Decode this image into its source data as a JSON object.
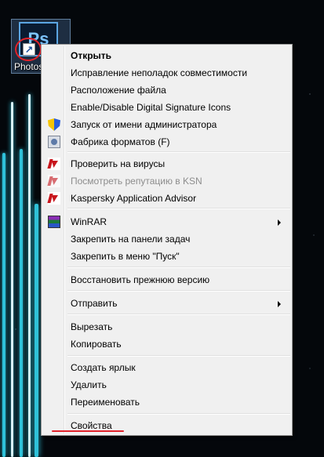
{
  "desktop": {
    "icon_label": "Photoshop",
    "icon_glyph": "Ps",
    "shortcut_glyph": "↗",
    "beam_color": "#2fc1d9",
    "annotation_color": "#e0222a"
  },
  "context_menu": {
    "items": [
      {
        "label": "Открыть",
        "bold": true,
        "icon": null
      },
      {
        "label": "Исправление неполадок совместимости",
        "icon": null
      },
      {
        "label": "Расположение файла",
        "icon": null
      },
      {
        "label": "Enable/Disable Digital Signature Icons",
        "icon": null
      },
      {
        "label": "Запуск от имени администратора",
        "icon": "uac-shield-icon"
      },
      {
        "label": "Фабрика форматов (F)",
        "icon": "format-factory-icon"
      },
      {
        "label": "Проверить на вирусы",
        "icon": "kaspersky-icon"
      },
      {
        "label": "Посмотреть репутацию в KSN",
        "icon": "kaspersky-icon",
        "disabled": true
      },
      {
        "label": "Kaspersky Application Advisor",
        "icon": "kaspersky-icon"
      },
      {
        "label": "WinRAR",
        "icon": "winrar-icon",
        "submenu": true
      },
      {
        "label": "Закрепить на панели задач",
        "icon": null
      },
      {
        "label": "Закрепить в меню \"Пуск\"",
        "icon": null
      },
      {
        "label": "Восстановить прежнюю версию",
        "icon": null
      },
      {
        "label": "Отправить",
        "icon": null,
        "submenu": true
      },
      {
        "label": "Вырезать",
        "icon": null
      },
      {
        "label": "Копировать",
        "icon": null
      },
      {
        "label": "Создать ярлык",
        "icon": null
      },
      {
        "label": "Удалить",
        "icon": null
      },
      {
        "label": "Переименовать",
        "icon": null
      },
      {
        "label": "Свойства",
        "icon": null,
        "highlighted_annotation": true
      }
    ]
  }
}
